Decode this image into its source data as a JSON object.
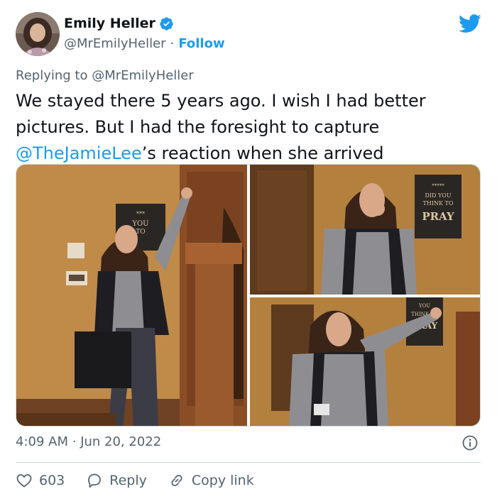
{
  "author": {
    "name": "Emily Heller",
    "handle": "@MrEmilyHeller",
    "separator": "·",
    "follow_label": "Follow"
  },
  "reply_context": {
    "prefix": "Replying to ",
    "mention": "@MrEmilyHeller"
  },
  "tweet": {
    "line1": "We stayed there 5 years ago. I wish I had better",
    "line2": "pictures. But I had the foresight to capture",
    "mention": "@TheJamieLee",
    "line3_rest": "’s reaction when she arrived"
  },
  "media": {
    "photo1_sign": [
      "***",
      "YOU",
      "TO"
    ],
    "photo2_sign": [
      "*****",
      "DID YOU",
      "THINK TO",
      "PRAY"
    ],
    "photo3_sign": [
      "YOU",
      "THINK TO",
      "PRAY"
    ]
  },
  "meta": {
    "time": "4:09 AM",
    "separator": "·",
    "date": "Jun 20, 2022"
  },
  "actions": {
    "likes": "603",
    "reply_label": "Reply",
    "copy_label": "Copy link"
  },
  "colors": {
    "accent": "#1d9bf0",
    "text": "#0f1419",
    "secondary": "#536471"
  }
}
